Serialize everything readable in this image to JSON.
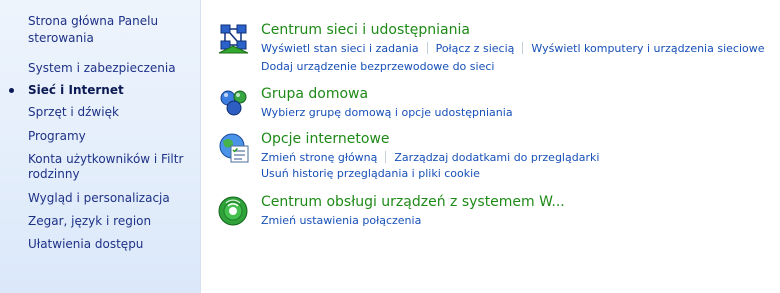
{
  "sidebar": {
    "home": "Strona główna Panelu sterowania",
    "items": [
      {
        "label": "System i zabezpieczenia",
        "active": false
      },
      {
        "label": "Sieć i Internet",
        "active": true
      },
      {
        "label": "Sprzęt i dźwięk",
        "active": false
      },
      {
        "label": "Programy",
        "active": false
      },
      {
        "label": "Konta użytkowników i Filtr rodzinny",
        "active": false
      },
      {
        "label": "Wygląd i personalizacja",
        "active": false
      },
      {
        "label": "Zegar, język i region",
        "active": false
      },
      {
        "label": "Ułatwienia dostępu",
        "active": false
      }
    ]
  },
  "sections": [
    {
      "title": "Centrum sieci i udostępniania",
      "icon": "network-center-icon",
      "links": [
        "Wyświetl stan sieci i zadania",
        "Połącz z siecią",
        "Wyświetl komputery i urządzenia sieciowe",
        "Dodaj urządzenie bezprzewodowe do sieci"
      ]
    },
    {
      "title": "Grupa domowa",
      "icon": "homegroup-icon",
      "links": [
        "Wybierz grupę domową i opcje udostępniania"
      ]
    },
    {
      "title": "Opcje internetowe",
      "icon": "internet-options-icon",
      "links": [
        "Zmień stronę główną",
        "Zarządzaj dodatkami do przeglądarki",
        "Usuń historię przeglądania i pliki cookie"
      ]
    },
    {
      "title": "Centrum obsługi urządzeń z systemem W...",
      "icon": "mobility-center-icon",
      "links": [
        "Zmień ustawienia połączenia"
      ]
    }
  ],
  "colors": {
    "title_green": "#1e8a17",
    "link_blue": "#1750b8",
    "sidebar_text": "#1e3287"
  }
}
